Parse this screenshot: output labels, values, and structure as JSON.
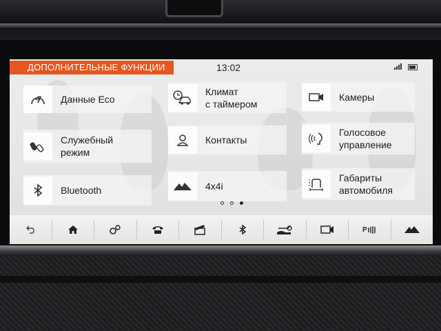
{
  "header": {
    "title": "ДОПОЛНИТЕЛЬНЫЕ ФУНКЦИИ",
    "time": "13:02",
    "accent_color": "#e5571d"
  },
  "tiles": [
    {
      "label": "Данные Eco",
      "icon": "eco-gauge-icon"
    },
    {
      "label": "Климат\nс таймером",
      "icon": "climate-timer-icon"
    },
    {
      "label": "Камеры",
      "icon": "camera-icon"
    },
    {
      "label": "Служебный\nрежим",
      "icon": "service-keys-icon"
    },
    {
      "label": "Контакты",
      "icon": "contact-person-icon"
    },
    {
      "label": "Голосовое\nуправление",
      "icon": "voice-control-icon"
    },
    {
      "label": "Bluetooth",
      "icon": "bluetooth-icon"
    },
    {
      "label": "4x4i",
      "icon": "terrain-icon"
    },
    {
      "label": "Габариты\nавтомобиля",
      "icon": "vehicle-dimensions-icon"
    }
  ],
  "pagination": {
    "pages": 3,
    "current": 3
  },
  "bottom_bar": [
    {
      "name": "back",
      "icon": "back-arrow-icon"
    },
    {
      "name": "home",
      "icon": "home-icon"
    },
    {
      "name": "settings",
      "icon": "settings-gears-icon"
    },
    {
      "name": "phone",
      "icon": "phone-icon"
    },
    {
      "name": "media",
      "icon": "media-clapper-icon"
    },
    {
      "name": "bluetooth",
      "icon": "bluetooth-icon"
    },
    {
      "name": "vehicle",
      "icon": "vehicle-hand-icon"
    },
    {
      "name": "camera",
      "icon": "camera-icon"
    },
    {
      "name": "parking",
      "icon": "parking-aid-icon"
    },
    {
      "name": "terrain",
      "icon": "terrain-icon"
    }
  ]
}
